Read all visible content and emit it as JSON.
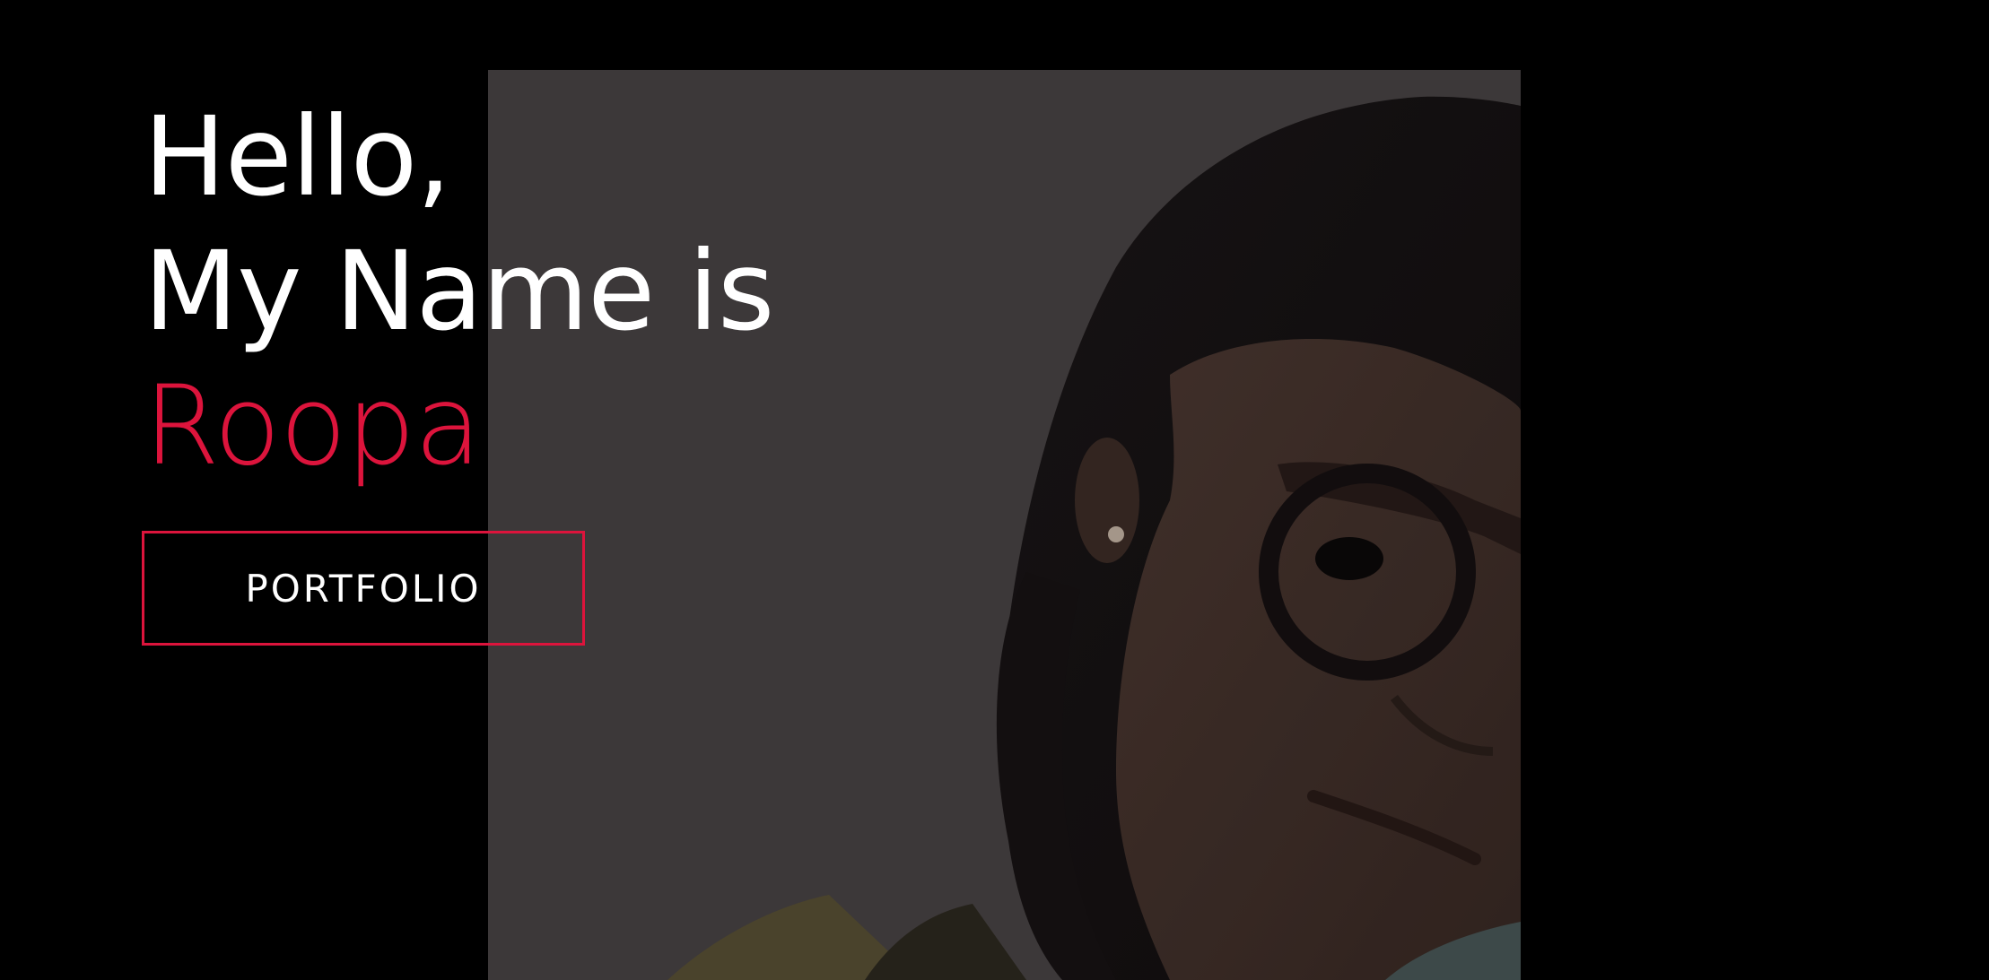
{
  "hero": {
    "greeting": "Hello,",
    "intro": "My Name is",
    "name": "Roopa",
    "button_label": "PORTFOLIO",
    "portrait_alt": "profile-photo"
  },
  "colors": {
    "background": "#000000",
    "text": "#ffffff",
    "accent": "#dc143c"
  }
}
